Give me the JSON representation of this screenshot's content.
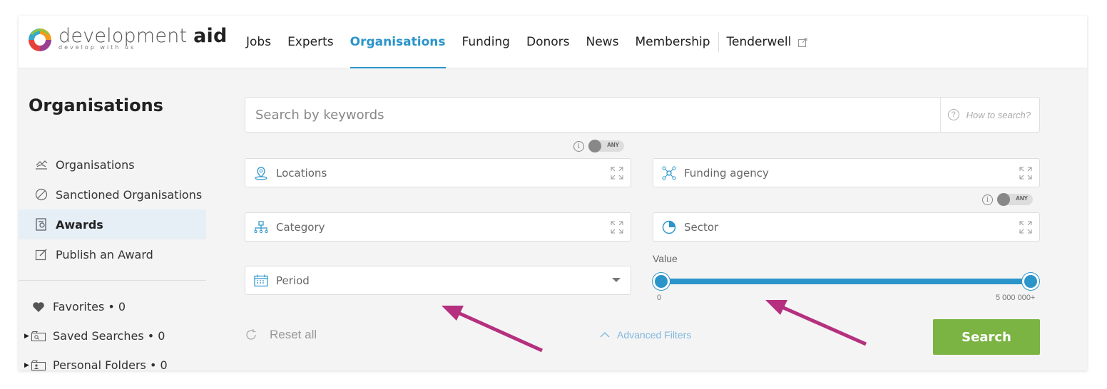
{
  "brand": {
    "name_light": "development",
    "name_bold": "aid",
    "tagline": "develop with us"
  },
  "nav": {
    "items": [
      {
        "label": "Jobs"
      },
      {
        "label": "Experts"
      },
      {
        "label": "Organisations"
      },
      {
        "label": "Funding"
      },
      {
        "label": "Donors"
      },
      {
        "label": "News"
      },
      {
        "label": "Membership"
      }
    ],
    "tenderwell": "Tenderwell",
    "active": "Organisations"
  },
  "sidebar": {
    "title": "Organisations",
    "items": [
      {
        "label": "Organisations",
        "icon": "organisations-icon"
      },
      {
        "label": "Sanctioned Organisations",
        "icon": "ban-icon"
      },
      {
        "label": "Awards",
        "icon": "award-icon",
        "active": true
      },
      {
        "label": "Publish an Award",
        "icon": "edit-icon"
      }
    ],
    "personal": [
      {
        "label": "Favorites • 0",
        "icon": "heart-icon"
      },
      {
        "label": "Saved Searches • 0",
        "icon": "saved-search-icon"
      },
      {
        "label": "Personal Folders • 0",
        "icon": "folder-icon"
      }
    ]
  },
  "search": {
    "placeholder": "Search by keywords",
    "how_to": "How to search?"
  },
  "toggles": {
    "any_label": "ANY",
    "info": "i"
  },
  "filters": {
    "locations": "Locations",
    "funding_agency": "Funding agency",
    "category": "Category",
    "sector": "Sector",
    "period": "Period"
  },
  "value_filter": {
    "label": "Value",
    "min_label": "0",
    "max_label": "5 000 000+",
    "selected_min_fraction": 0.0,
    "selected_max_fraction": 1.0
  },
  "actions": {
    "reset": "Reset all",
    "advanced": "Advanced Filters",
    "search": "Search"
  },
  "colors": {
    "accent": "#2b94c9",
    "search_button": "#7bb443",
    "active_sidebar": "#e6eef6",
    "annotation_arrow": "#b5307f"
  }
}
